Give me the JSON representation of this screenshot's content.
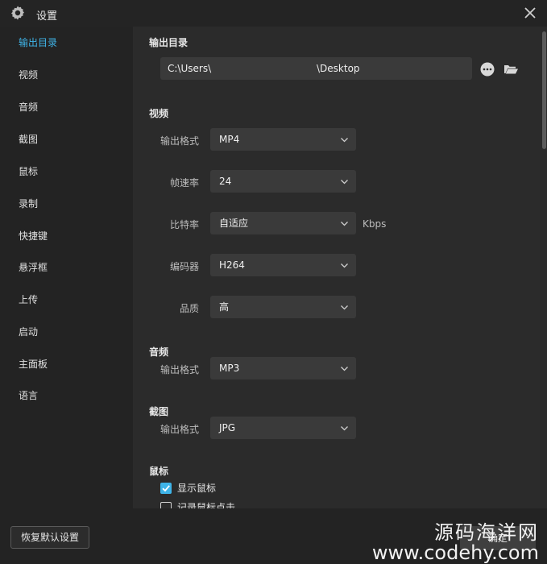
{
  "window": {
    "title": "设置"
  },
  "sidebar": {
    "items": [
      {
        "label": "输出目录",
        "active": true
      },
      {
        "label": "视频"
      },
      {
        "label": "音频"
      },
      {
        "label": "截图"
      },
      {
        "label": "鼠标"
      },
      {
        "label": "录制"
      },
      {
        "label": "快捷键"
      },
      {
        "label": "悬浮框"
      },
      {
        "label": "上传"
      },
      {
        "label": "启动"
      },
      {
        "label": "主面板"
      },
      {
        "label": "语言"
      }
    ]
  },
  "output": {
    "title": "输出目录",
    "path_prefix": "C:\\Users\\",
    "path_suffix": "\\Desktop"
  },
  "video": {
    "title": "视频",
    "format_label": "输出格式",
    "format_value": "MP4",
    "fps_label": "帧速率",
    "fps_value": "24",
    "bitrate_label": "比特率",
    "bitrate_value": "自适应",
    "bitrate_unit": "Kbps",
    "encoder_label": "编码器",
    "encoder_value": "H264",
    "quality_label": "品质",
    "quality_value": "高"
  },
  "audio": {
    "title": "音频",
    "format_label": "输出格式",
    "format_value": "MP3"
  },
  "screenshot": {
    "title": "截图",
    "format_label": "输出格式",
    "format_value": "JPG"
  },
  "mouse": {
    "title": "鼠标",
    "show_cursor_label": "显示鼠标",
    "show_cursor_checked": true,
    "record_clicks_label": "记录鼠标点击",
    "record_clicks_checked": false
  },
  "footer": {
    "reset_label": "恢复默认设置",
    "ok_label": "确定",
    "watermark_line1": "源码海洋网",
    "watermark_line2": "www.codehy.com"
  },
  "colors": {
    "accent": "#3fb4e8",
    "background": "#2b2b2b",
    "sidebar": "#232323",
    "field": "#3a3a3a"
  },
  "icons": {
    "app": "gear-icon",
    "close": "close-icon",
    "more": "more-options-icon",
    "folder": "folder-open-icon",
    "dropdown": "chevron-down-icon"
  }
}
